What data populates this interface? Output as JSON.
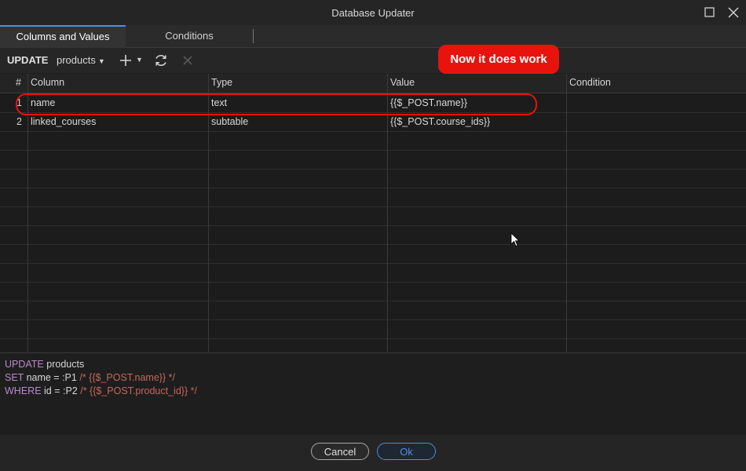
{
  "window": {
    "title": "Database Updater"
  },
  "tabs": [
    {
      "label": "Columns and Values"
    },
    {
      "label": "Conditions"
    }
  ],
  "toolbar": {
    "action": "UPDATE",
    "table": "products"
  },
  "annotation": {
    "text": "Now it does work"
  },
  "grid": {
    "headers": [
      "#",
      "Column",
      "Type",
      "Value",
      "Condition"
    ],
    "rows": [
      {
        "num": "1",
        "column": "name",
        "type": "text",
        "value": "{{$_POST.name}}",
        "condition": ""
      },
      {
        "num": "2",
        "column": "linked_courses",
        "type": "subtable",
        "value": "{{$_POST.course_ids}}",
        "condition": ""
      }
    ]
  },
  "sql": {
    "l1_kw": "UPDATE",
    "l1_tx": " products",
    "l2_kw": "SET",
    "l2_tx": " name = :P1 ",
    "l2_cm": "/* {{$_POST.name}} */",
    "l3_kw": "WHERE",
    "l3_tx": " id = :P2 ",
    "l3_cm": "/* {{$_POST.product_id}} */"
  },
  "buttons": {
    "cancel": "Cancel",
    "ok": "Ok"
  },
  "colors": {
    "accent": "#4a90e2",
    "annotation": "#e8130d",
    "keyword": "#b88ac9",
    "comment": "#c7675c"
  }
}
